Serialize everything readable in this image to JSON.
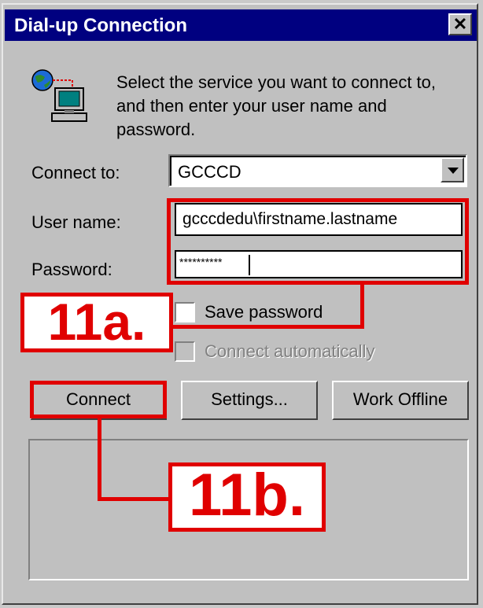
{
  "window": {
    "title": "Dial-up Connection",
    "close_glyph": "✕"
  },
  "instruction": "Select the service you want to connect to, and then enter your user name and password.",
  "icon": "network-computer-icon",
  "fields": {
    "connect_to_label": "Connect to:",
    "connect_to_value": "GCCCD",
    "user_name_label": "User name:",
    "user_name_value": "gcccdedu\\firstname.lastname",
    "password_label": "Password:",
    "password_value": "**********"
  },
  "options": {
    "save_password": "Save password",
    "connect_automatically": "Connect automatically"
  },
  "buttons": {
    "connect": "Connect",
    "settings": "Settings...",
    "work_offline": "Work Offline"
  },
  "annotations": {
    "callout_a": "11a.",
    "callout_b": "11b.",
    "color": "#e00000"
  }
}
